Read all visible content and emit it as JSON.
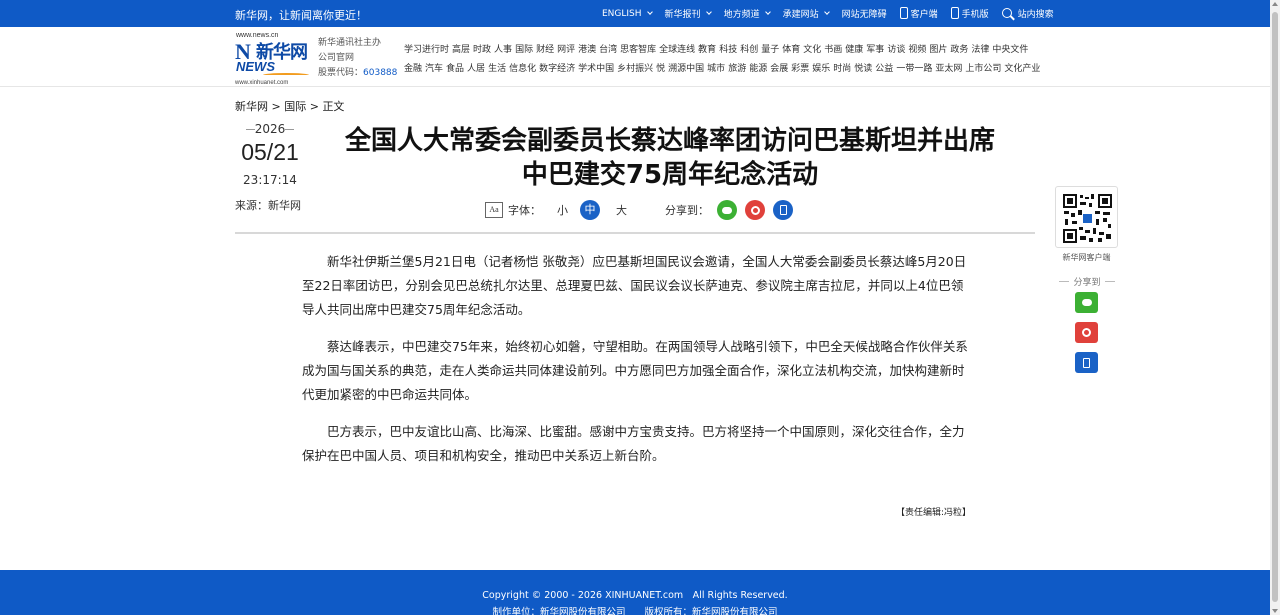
{
  "topbar": {
    "slogan": "新华网，让新闻离你更近！",
    "nav": [
      {
        "label": "ENGLISH",
        "has_dropdown": true
      },
      {
        "label": "新华报刊",
        "has_dropdown": true
      },
      {
        "label": "地方频道",
        "has_dropdown": true
      },
      {
        "label": "承建网站",
        "has_dropdown": true
      },
      {
        "label": "网站无障碍",
        "has_dropdown": false
      }
    ],
    "client_label": "客户端",
    "mobile_label": "手机版",
    "search_label": "站内搜索"
  },
  "logo": {
    "url_top": "www.news.cn",
    "cn_text": "新华网",
    "en_text": "NEWS",
    "url_bottom": "www.xinhuanet.com"
  },
  "corp": {
    "line1": "新华通讯社主办",
    "line2": "公司官网",
    "stock_label": "股票代码：",
    "stock_code": "603888"
  },
  "nav": {
    "row1": [
      "学习进行时",
      "高层",
      "时政",
      "人事",
      "国际",
      "财经",
      "网评",
      "港澳",
      "台湾",
      "思客智库",
      "全球连线",
      "教育",
      "科技",
      "科创",
      "量子",
      "体育",
      "文化",
      "书画",
      "健康",
      "军事",
      "访谈",
      "视频",
      "图片",
      "政务",
      "法律",
      "中央文件"
    ],
    "row2": [
      "金融",
      "汽车",
      "食品",
      "人居",
      "生活",
      "信息化",
      "数字经济",
      "学术中国",
      "乡村振兴",
      "悦",
      "溯源中国",
      "城市",
      "旅游",
      "能源",
      "会展",
      "彩票",
      "娱乐",
      "时尚",
      "悦读",
      "公益",
      "一带一路",
      "亚太网",
      "上市公司",
      "文化产业"
    ]
  },
  "breadcrumb": {
    "home": "新华网",
    "section": "国际",
    "current": "正文",
    "sep": ">"
  },
  "article": {
    "year": "2026",
    "month_day": "05/21",
    "time": "23:17:14",
    "source": "来源：新华网",
    "title": "全国人大常委会副委员长蔡达峰率团访问巴基斯坦并出席中巴建交75周年纪念活动",
    "font_label": "字体：",
    "size_small": "小",
    "size_medium": "中",
    "size_large": "大",
    "share_label": "分享到：",
    "paragraphs": [
      "新华社伊斯兰堡5月21日电（记者杨恺 张敬尧）应巴基斯坦国民议会邀请，全国人大常委会副委员长蔡达峰5月20日至22日率团访巴，分别会见巴总统扎尔达里、总理夏巴兹、国民议会议长萨迪克、参议院主席吉拉尼，并同以上4位巴领导人共同出席中巴建交75周年纪念活动。",
      "蔡达峰表示，中巴建交75年来，始终初心如磐，守望相助。在两国领导人战略引领下，中巴全天候战略合作伙伴关系成为国与国关系的典范，走在人类命运共同体建设前列。中方愿同巴方加强全面合作，深化立法机构交流，加快构建新时代更加紧密的中巴命运共同体。",
      "巴方表示，巴中友谊比山高、比海深、比蜜甜。感谢中方宝贵支持。巴方将坚持一个中国原则，深化交往合作，全力保护在巴中国人员、项目和机构安全，推动巴中关系迈上新台阶。"
    ],
    "editor": "【责任编辑:冯粒】"
  },
  "sidebar": {
    "qr_label": "新华网客户端",
    "share_label": "分享到"
  },
  "footer": {
    "copyright": "Copyright © 2000 - 2026 XINHUANET.com　All Rights Reserved.",
    "producer": "制作单位：新华网股份有限公司",
    "owner": "版权所有：新华网股份有限公司"
  },
  "colors": {
    "brand_blue": "#0f5ac6",
    "wechat_green": "#3cb034",
    "weibo_red": "#e0413b"
  }
}
